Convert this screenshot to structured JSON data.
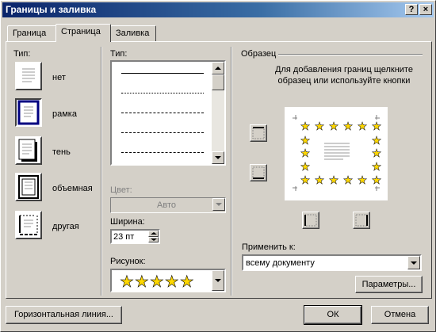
{
  "window": {
    "title": "Границы и заливка",
    "help_label": "?",
    "close_label": "×"
  },
  "tabs": [
    {
      "label": "Граница"
    },
    {
      "label": "Страница"
    },
    {
      "label": "Заливка"
    }
  ],
  "type_section": {
    "label": "Тип:",
    "items": [
      {
        "label": "нет",
        "selected": false
      },
      {
        "label": "рамка",
        "selected": true
      },
      {
        "label": "тень",
        "selected": false
      },
      {
        "label": "объемная",
        "selected": false
      },
      {
        "label": "другая",
        "selected": false
      }
    ]
  },
  "style_section": {
    "type_label": "Тип:",
    "line_styles": [
      "solid",
      "dotted",
      "dashed",
      "long-dash",
      "dash-dot"
    ],
    "color_label": "Цвет:",
    "color_value": "Авто",
    "width_label": "Ширина:",
    "width_value": "23 пт",
    "art_label": "Рисунок:",
    "art_value": "★★★★★"
  },
  "preview": {
    "label": "Образец",
    "hint": "Для добавления границ щелкните образец или используйте кнопки",
    "star_glyph": "★",
    "apply_label": "Применить к:",
    "apply_value": "всему документу",
    "options_label": "Параметры..."
  },
  "footer": {
    "hline_label": "Горизонтальная линия...",
    "ok_label": "ОК",
    "cancel_label": "Отмена"
  },
  "colors": {
    "titlebar_start": "#0a246a",
    "titlebar_end": "#a6caf0",
    "face": "#d4d0c8",
    "star": "#ffd800"
  }
}
